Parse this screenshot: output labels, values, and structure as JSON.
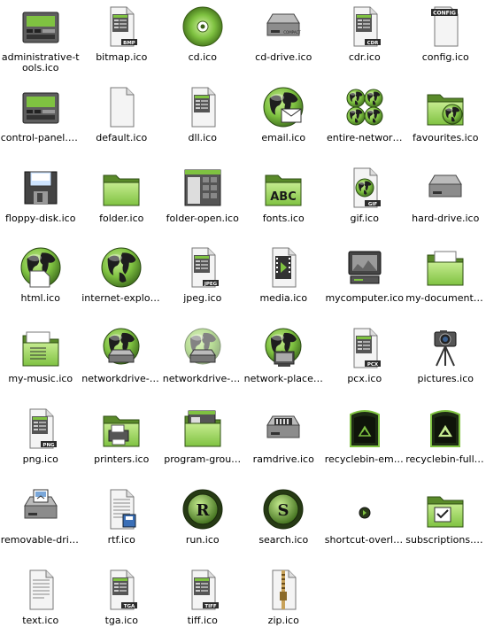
{
  "files": [
    {
      "label": "administrative-tools.ico",
      "icon": "control-panel-icon"
    },
    {
      "label": "bitmap.ico",
      "icon": "bmp-file-icon",
      "tag": "BMP"
    },
    {
      "label": "cd.ico",
      "icon": "cd-icon"
    },
    {
      "label": "cd-drive.ico",
      "icon": "cd-drive-icon"
    },
    {
      "label": "cdr.ico",
      "icon": "cdr-file-icon",
      "tag": "CDR"
    },
    {
      "label": "config.ico",
      "icon": "config-file-icon",
      "tag": "CONFIG"
    },
    {
      "label": "control-panel.ico",
      "icon": "control-panel-icon"
    },
    {
      "label": "default.ico",
      "icon": "default-file-icon"
    },
    {
      "label": "dll.ico",
      "icon": "dll-file-icon"
    },
    {
      "label": "email.ico",
      "icon": "email-icon"
    },
    {
      "label": "entire-networ…",
      "icon": "entire-network-icon"
    },
    {
      "label": "favourites.ico",
      "icon": "favourites-icon"
    },
    {
      "label": "floppy-disk.ico",
      "icon": "floppy-disk-icon"
    },
    {
      "label": "folder.ico",
      "icon": "folder-icon"
    },
    {
      "label": "folder-open.ico",
      "icon": "folder-open-icon"
    },
    {
      "label": "fonts.ico",
      "icon": "fonts-icon",
      "tag": "ABC"
    },
    {
      "label": "gif.ico",
      "icon": "gif-file-icon",
      "tag": "GIF"
    },
    {
      "label": "hard-drive.ico",
      "icon": "hard-drive-icon"
    },
    {
      "label": "html.ico",
      "icon": "html-icon"
    },
    {
      "label": "internet-explor…",
      "icon": "internet-explorer-icon"
    },
    {
      "label": "jpeg.ico",
      "icon": "jpeg-file-icon",
      "tag": "JPEG"
    },
    {
      "label": "media.ico",
      "icon": "media-file-icon"
    },
    {
      "label": "mycomputer.ico",
      "icon": "my-computer-icon"
    },
    {
      "label": "my-documents.ico",
      "icon": "my-documents-icon"
    },
    {
      "label": "my-music.ico",
      "icon": "my-music-icon"
    },
    {
      "label": "networkdrive-c…",
      "icon": "network-drive-connected-icon"
    },
    {
      "label": "networkdrive-d…",
      "icon": "network-drive-disconnected-icon"
    },
    {
      "label": "network-place…",
      "icon": "network-places-icon"
    },
    {
      "label": "pcx.ico",
      "icon": "pcx-file-icon",
      "tag": "PCX"
    },
    {
      "label": "pictures.ico",
      "icon": "pictures-icon"
    },
    {
      "label": "png.ico",
      "icon": "png-file-icon",
      "tag": "PNG"
    },
    {
      "label": "printers.ico",
      "icon": "printers-icon"
    },
    {
      "label": "program-grou…",
      "icon": "program-group-icon"
    },
    {
      "label": "ramdrive.ico",
      "icon": "ramdrive-icon"
    },
    {
      "label": "recyclebin-emp…",
      "icon": "recyclebin-empty-icon"
    },
    {
      "label": "recyclebin-full.ico",
      "icon": "recyclebin-full-icon"
    },
    {
      "label": "removable-driv…",
      "icon": "removable-drive-icon"
    },
    {
      "label": "rtf.ico",
      "icon": "rtf-file-icon"
    },
    {
      "label": "run.ico",
      "icon": "run-icon",
      "tag": "R"
    },
    {
      "label": "search.ico",
      "icon": "search-icon",
      "tag": "S"
    },
    {
      "label": "shortcut-overla…",
      "icon": "shortcut-overlay-icon"
    },
    {
      "label": "subscriptions.ico",
      "icon": "subscriptions-icon"
    },
    {
      "label": "text.ico",
      "icon": "text-file-icon"
    },
    {
      "label": "tga.ico",
      "icon": "tga-file-icon",
      "tag": "TGA"
    },
    {
      "label": "tiff.ico",
      "icon": "tiff-file-icon",
      "tag": "TIFF"
    },
    {
      "label": "zip.ico",
      "icon": "zip-file-icon"
    }
  ],
  "colors": {
    "green": "#7fc241",
    "green_dark": "#3d6b1c",
    "green_light": "#c6ec8f",
    "gray": "#6d6d6d",
    "gray_dark": "#333333",
    "paper": "#f4f4f4"
  }
}
